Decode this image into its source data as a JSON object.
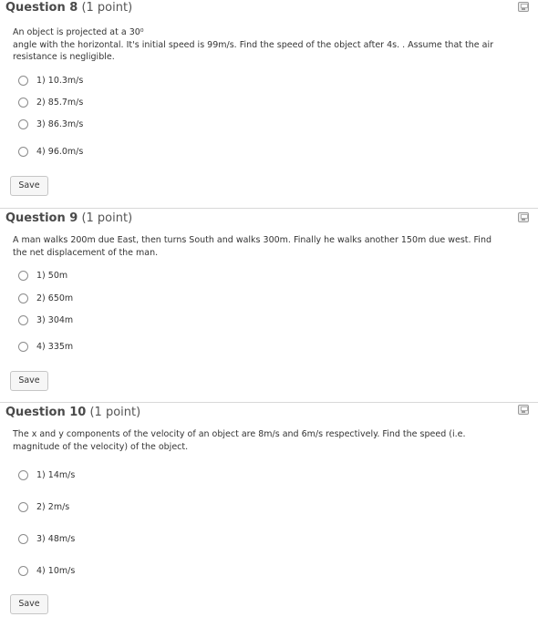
{
  "questions": [
    {
      "title": "Question 8",
      "points": "(1 point)",
      "text_line1": "An object is projected at a 30⁰",
      "text_line2": "angle with the horizontal. It's initial speed is 99m/s. Find the speed of the object after 4s. . Assume that the air",
      "text_line3": "resistance is negligible.",
      "options": [
        "1) 10.3m/s",
        "2) 85.7m/s",
        "3) 86.3m/s",
        "4) 96.0m/s"
      ],
      "save_label": "Save"
    },
    {
      "title": "Question 9",
      "points": "(1 point)",
      "text_line1": "A man walks 200m due East, then turns South and walks 300m. Finally he walks another 150m due west. Find",
      "text_line2": "the net displacement of the man.",
      "options": [
        "1) 50m",
        "2) 650m",
        "3) 304m",
        "4) 335m"
      ],
      "save_label": "Save"
    },
    {
      "title": "Question 10",
      "points": "(1 point)",
      "text_line1": "The x and y components of the velocity of an object are 8m/s and 6m/s respectively. Find the speed (i.e.",
      "text_line2": "magnitude of the velocity) of the object.",
      "options": [
        "1) 14m/s",
        "2) 2m/s",
        "3) 48m/s",
        "4) 10m/s"
      ],
      "save_label": "Save"
    }
  ],
  "icons": {
    "save_icon": "floppy-disk-icon",
    "radio": "radio-button-unselected"
  }
}
